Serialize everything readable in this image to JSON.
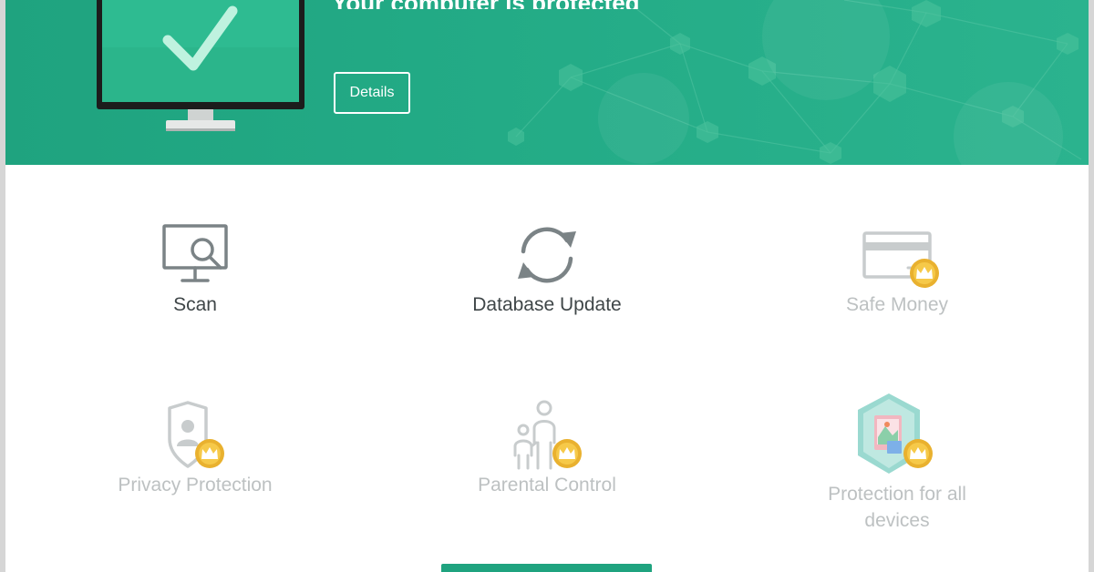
{
  "banner": {
    "title": "Your computer is protected",
    "details_label": "Details"
  },
  "tiles": [
    {
      "label": "Scan",
      "icon": "monitor-scan-icon",
      "premium": false
    },
    {
      "label": "Database Update",
      "icon": "sync-icon",
      "premium": false
    },
    {
      "label": "Safe Money",
      "icon": "credit-card-icon",
      "premium": true
    },
    {
      "label": "Privacy Protection",
      "icon": "shield-user-icon",
      "premium": true
    },
    {
      "label": "Parental Control",
      "icon": "family-icon",
      "premium": true
    },
    {
      "label": "Protection for all devices",
      "icon": "devices-map-icon",
      "premium": true
    }
  ],
  "colors": {
    "brand_green": "#1fa37f",
    "crown_gold": "#e9b12f",
    "text_active": "#3f4648",
    "text_disabled": "#bdc1c2"
  }
}
